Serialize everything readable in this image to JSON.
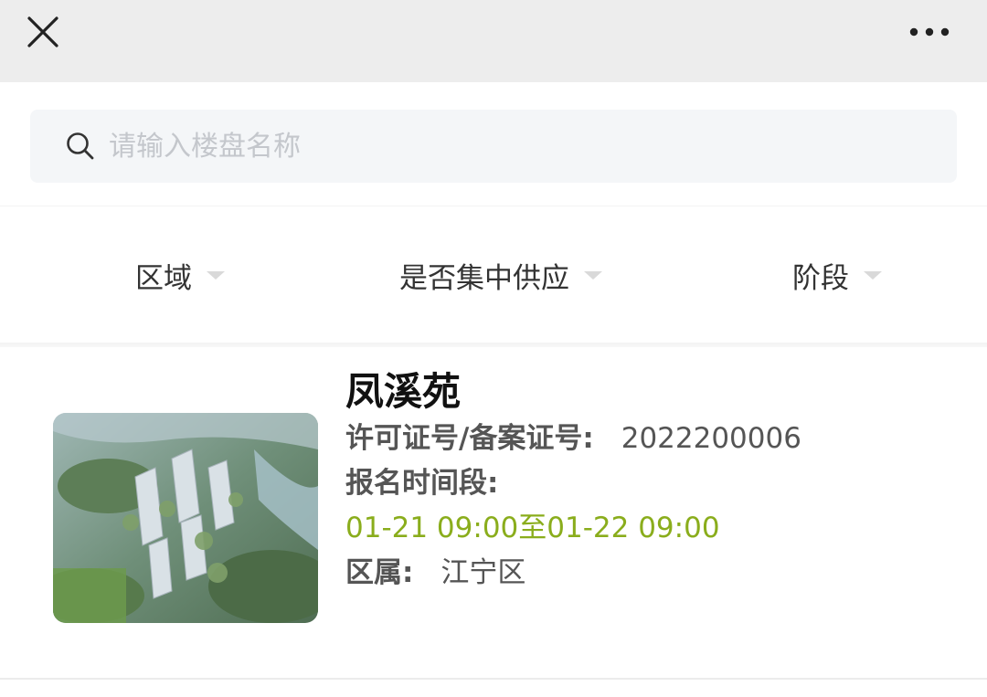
{
  "topbar": {
    "close_icon": "close-icon",
    "more_icon": "more-horizontal-icon"
  },
  "search": {
    "placeholder": "请输入楼盘名称",
    "value": "",
    "icon": "search-icon"
  },
  "filters": [
    {
      "label": "区域"
    },
    {
      "label": "是否集中供应"
    },
    {
      "label": "阶段"
    }
  ],
  "listings": [
    {
      "name": "凤溪苑",
      "permit_label": "许可证号/备案证号:",
      "permit_value": "2022200006",
      "signup_label": "报名时间段:",
      "signup_time": "01-21 09:00至01-22 09:00",
      "district_label": "区属:",
      "district_value": "江宁区"
    }
  ],
  "colors": {
    "topbar_bg": "#ededed",
    "search_bg": "#f4f6f8",
    "placeholder": "#c4c7cc",
    "time_accent": "#8aad1c",
    "title_text": "#111111",
    "body_text": "#555555"
  }
}
